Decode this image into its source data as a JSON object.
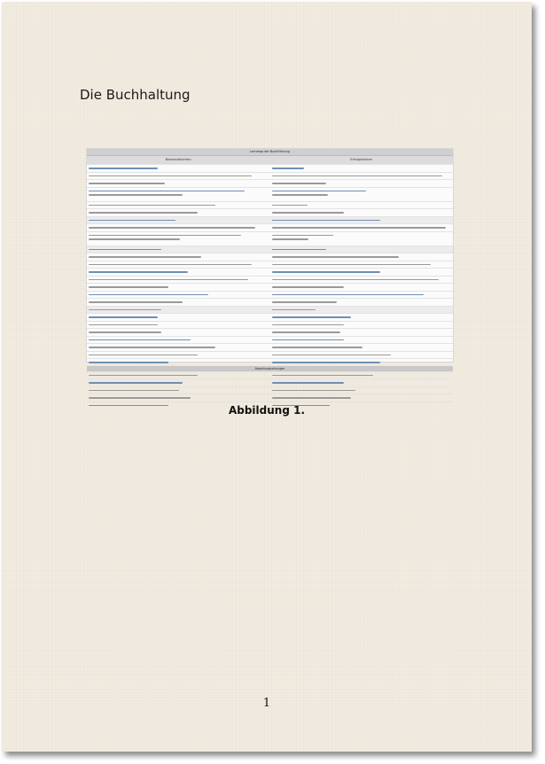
{
  "heading": "Die Buchhaltung",
  "table": {
    "title": "Lernmap der Buchführung",
    "col_left": "Bestandskonten",
    "col_right": "Erfolgskonten",
    "subheader": "Abschlussbuchungen"
  },
  "caption": "Abbildung 1.",
  "page_number": "1"
}
